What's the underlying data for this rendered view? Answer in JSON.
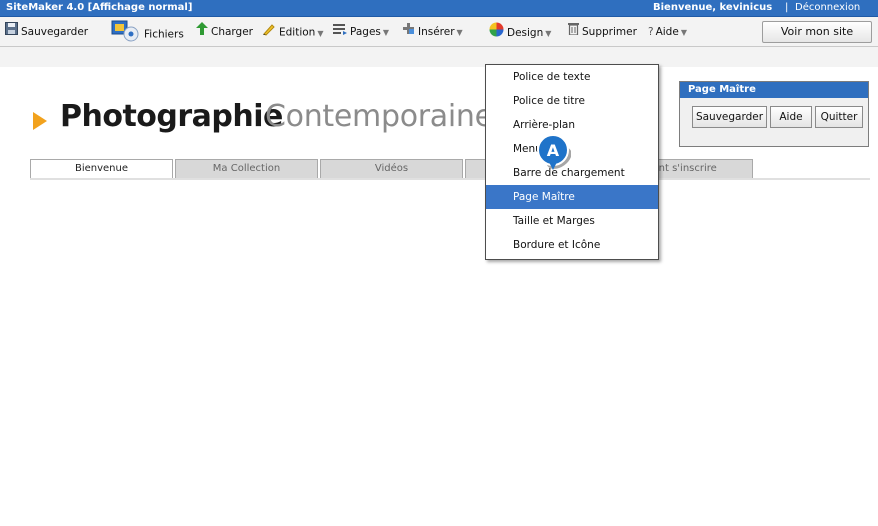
{
  "titlebar": {
    "app_title": "SiteMaker 4.0  [Affichage normal]",
    "welcome": "Bienvenue, kevinicus",
    "separator": "|",
    "logout": "Déconnexion"
  },
  "toolbar": {
    "save": "Sauvegarder",
    "files": "Fichiers",
    "upload": "Charger",
    "edit": "Edition",
    "pages": "Pages",
    "insert": "Insérer",
    "design": "Design",
    "delete": "Supprimer",
    "help": "Aide",
    "view_site": "Voir mon site"
  },
  "site": {
    "title_bold": "Photographie",
    "title_light": "Contemporaine",
    "tabs": [
      "Bienvenue",
      "Ma Collection",
      "Vidéos",
      "",
      "nent s'inscrire"
    ]
  },
  "design_menu": {
    "items": [
      "Police de texte",
      "Police de titre",
      "Arrière-plan",
      "Menu",
      "Barre de chargement",
      "Page Maître",
      "Taille et Marges",
      "Bordure et Icône"
    ],
    "selected": "Page Maître"
  },
  "master_panel": {
    "title": "Page Maître",
    "save": "Sauvegarder",
    "help": "Aide",
    "quit": "Quitter"
  },
  "marker": {
    "label": "A"
  },
  "colors": {
    "titlebar": "#2f6fbf",
    "highlight": "#3a76c8",
    "brand_arrow": "#f2a21d",
    "marker": "#1f73c9"
  }
}
